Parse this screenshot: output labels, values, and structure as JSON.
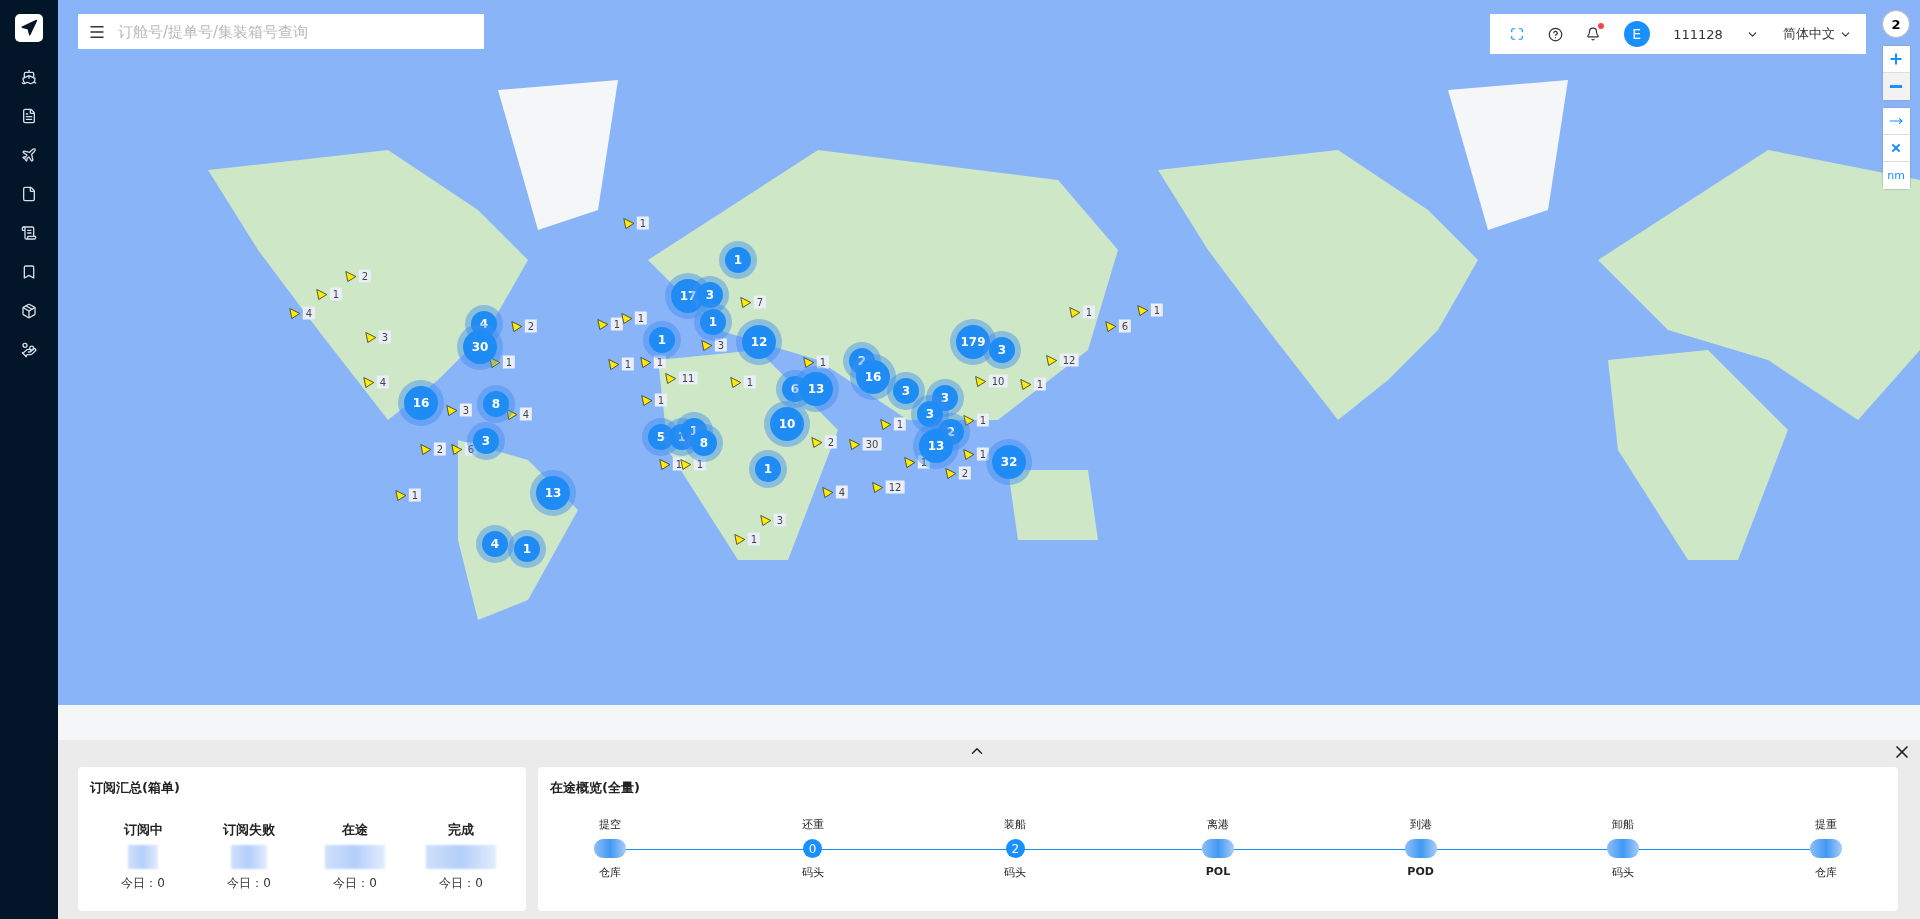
{
  "search": {
    "placeholder": "订舱号/提单号/集装箱号查询"
  },
  "header": {
    "notifications_unread": true,
    "avatar_letter": "E",
    "account": "111128",
    "language": "简体中文"
  },
  "map_controls": {
    "zoom_level": "2",
    "unit": "nm"
  },
  "clusters": [
    "1",
    "17",
    "3",
    "1",
    "4",
    "30",
    "1",
    "12",
    "179",
    "3",
    "2",
    "16",
    "6",
    "13",
    "3",
    "3",
    "16",
    "8",
    "10",
    "3",
    "2",
    "3",
    "5",
    "1",
    "1",
    "8",
    "13",
    "32",
    "1",
    "13",
    "4",
    "1"
  ],
  "ships": [
    "1",
    "2",
    "1",
    "4",
    "3",
    "4",
    "2",
    "1",
    "1",
    "1",
    "1",
    "7",
    "3",
    "1",
    "11",
    "1",
    "1",
    "1",
    "2",
    "1",
    "30",
    "1",
    "12",
    "2",
    "1",
    "1",
    "10",
    "1",
    "12",
    "1",
    "6",
    "1",
    "3",
    "4",
    "2",
    "6",
    "1",
    "1",
    "1",
    "4",
    "3",
    "1"
  ],
  "summary": {
    "title": "订阅汇总(箱单)",
    "stats": [
      {
        "label": "订阅中",
        "today": "今日：0"
      },
      {
        "label": "订阅失败",
        "today": "今日：0"
      },
      {
        "label": "在途",
        "today": "今日：0"
      },
      {
        "label": "完成",
        "today": "今日：0"
      }
    ]
  },
  "overview": {
    "title": "在途概览(全量)",
    "steps": [
      {
        "label": "提空",
        "kind": "blurred",
        "place": "仓库",
        "bold": false
      },
      {
        "label": "还重",
        "kind": "count",
        "count": "0",
        "place": "码头",
        "bold": false
      },
      {
        "label": "装船",
        "kind": "count",
        "count": "2",
        "place": "码头",
        "bold": false
      },
      {
        "label": "离港",
        "kind": "blurred",
        "place": "POL",
        "bold": true
      },
      {
        "label": "到港",
        "kind": "blurred",
        "place": "POD",
        "bold": true
      },
      {
        "label": "卸船",
        "kind": "blurred",
        "place": "码头",
        "bold": false
      },
      {
        "label": "提重",
        "kind": "blurred",
        "place": "仓库",
        "bold": false
      }
    ]
  }
}
